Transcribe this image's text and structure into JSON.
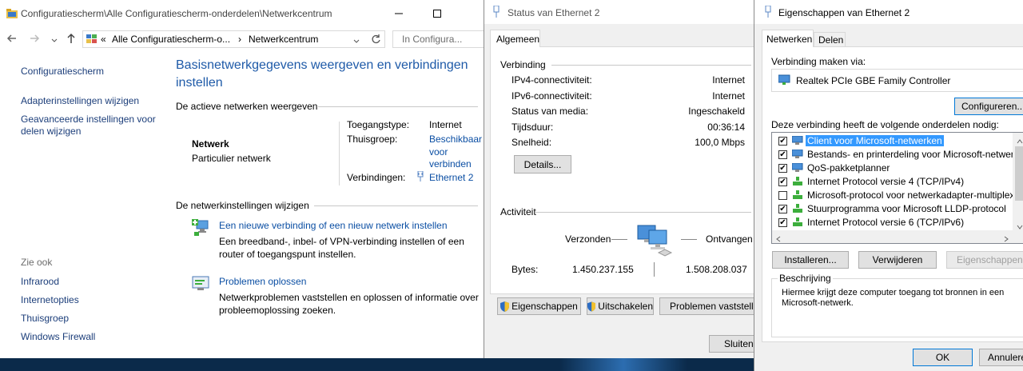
{
  "taskbar": {
    "color": "#0b2a4a"
  },
  "cp": {
    "title": "Configuratiescherm\\Alle Configuratiescherm-onderdelen\\Netwerkcentrum",
    "address_crumb1": "Alle Configuratiescherm-o...",
    "address_crumb2": "Netwerkcentrum",
    "search_placeholder": "In Configura...",
    "sidebar": {
      "home": "Configuratiescherm",
      "adapter": "Adapterinstellingen wijzigen",
      "advanced_line1": "Geavanceerde instellingen voor",
      "advanced_line2": "delen wijzigen",
      "see_also": "Zie ook",
      "infrared": "Infrarood",
      "internet_options": "Internetopties",
      "homegroup": "Thuisgroep",
      "firewall": "Windows Firewall"
    },
    "heading_line1": "Basisnetwerkgegevens weergeven en verbindingen",
    "heading_line2": "instellen",
    "active_networks": "De actieve netwerken weergeven",
    "network_name": "Netwerk",
    "network_type": "Particulier netwerk",
    "access_type_label": "Toegangstype:",
    "access_type_value": "Internet",
    "homegroup_label": "Thuisgroep:",
    "homegroup_value_1": "Beschikbaar",
    "homegroup_value_2": "voor",
    "homegroup_value_3": "verbinden",
    "connections_label": "Verbindingen:",
    "connections_value": "Ethernet 2",
    "change_settings": "De netwerkinstellingen wijzigen",
    "new_conn_link": "Een nieuwe verbinding of een nieuw netwerk instellen",
    "new_conn_desc1": "Een breedband-, inbel- of VPN-verbinding instellen of een",
    "new_conn_desc2": "router of toegangspunt instellen.",
    "troubleshoot_link": "Problemen oplossen",
    "troubleshoot_desc1": "Netwerkproblemen vaststellen en oplossen of informatie over",
    "troubleshoot_desc2": "probleemoplossing zoeken."
  },
  "status": {
    "title": "Status van Ethernet 2",
    "tab": "Algemeen",
    "connection_group": "Verbinding",
    "rows": [
      {
        "label": "IPv4-connectiviteit:",
        "value": "Internet"
      },
      {
        "label": "IPv6-connectiviteit:",
        "value": "Internet"
      },
      {
        "label": "Status van media:",
        "value": "Ingeschakeld"
      },
      {
        "label": "Tijdsduur:",
        "value": "00:36:14"
      },
      {
        "label": "Snelheid:",
        "value": "100,0 Mbps"
      }
    ],
    "details_button": "Details...",
    "activity_group": "Activiteit",
    "sent": "Verzonden",
    "received": "Ontvangen",
    "bytes_label": "Bytes:",
    "bytes_sent": "1.450.237.155",
    "bytes_received": "1.508.208.037",
    "properties_button": "Eigenschappen",
    "disable_button": "Uitschakelen",
    "diagnose_button": "Problemen vaststellen",
    "close_button": "Sluiten"
  },
  "props": {
    "title": "Eigenschappen van Ethernet 2",
    "tab_networks": "Netwerken",
    "tab_sharing": "Delen",
    "connect_using": "Verbinding maken via:",
    "adapter": "Realtek PCIe GBE Family Controller",
    "configure_button": "Configureren...",
    "items_label": "Deze verbinding heeft de volgende onderdelen nodig:",
    "items": [
      {
        "label": "Client voor Microsoft-netwerken",
        "checked": "✔",
        "icon": "client-icon"
      },
      {
        "label": "Bestands- en printerdeling voor Microsoft-netwerken",
        "checked": "✔",
        "icon": "share-icon"
      },
      {
        "label": "QoS-pakketplanner",
        "checked": "✔",
        "icon": "qos-icon"
      },
      {
        "label": "Internet Protocol versie 4 (TCP/IPv4)",
        "checked": "✔",
        "icon": "protocol-icon"
      },
      {
        "label": "Microsoft-protocol voor netwerkadapter-multiplexor",
        "checked": "",
        "icon": "protocol-icon"
      },
      {
        "label": "Stuurprogramma voor Microsoft LLDP-protocol",
        "checked": "✔",
        "icon": "protocol-icon"
      },
      {
        "label": "Internet Protocol versie 6 (TCP/IPv6)",
        "checked": "✔",
        "icon": "protocol-icon"
      }
    ],
    "install_button": "Installeren...",
    "uninstall_button": "Verwijderen",
    "properties_button": "Eigenschappen",
    "description_group": "Beschrijving",
    "description_line1": "Hiermee krijgt deze computer toegang tot bronnen in een",
    "description_line2": "Microsoft-netwerk.",
    "ok_button": "OK",
    "cancel_button": "Annuleren"
  }
}
